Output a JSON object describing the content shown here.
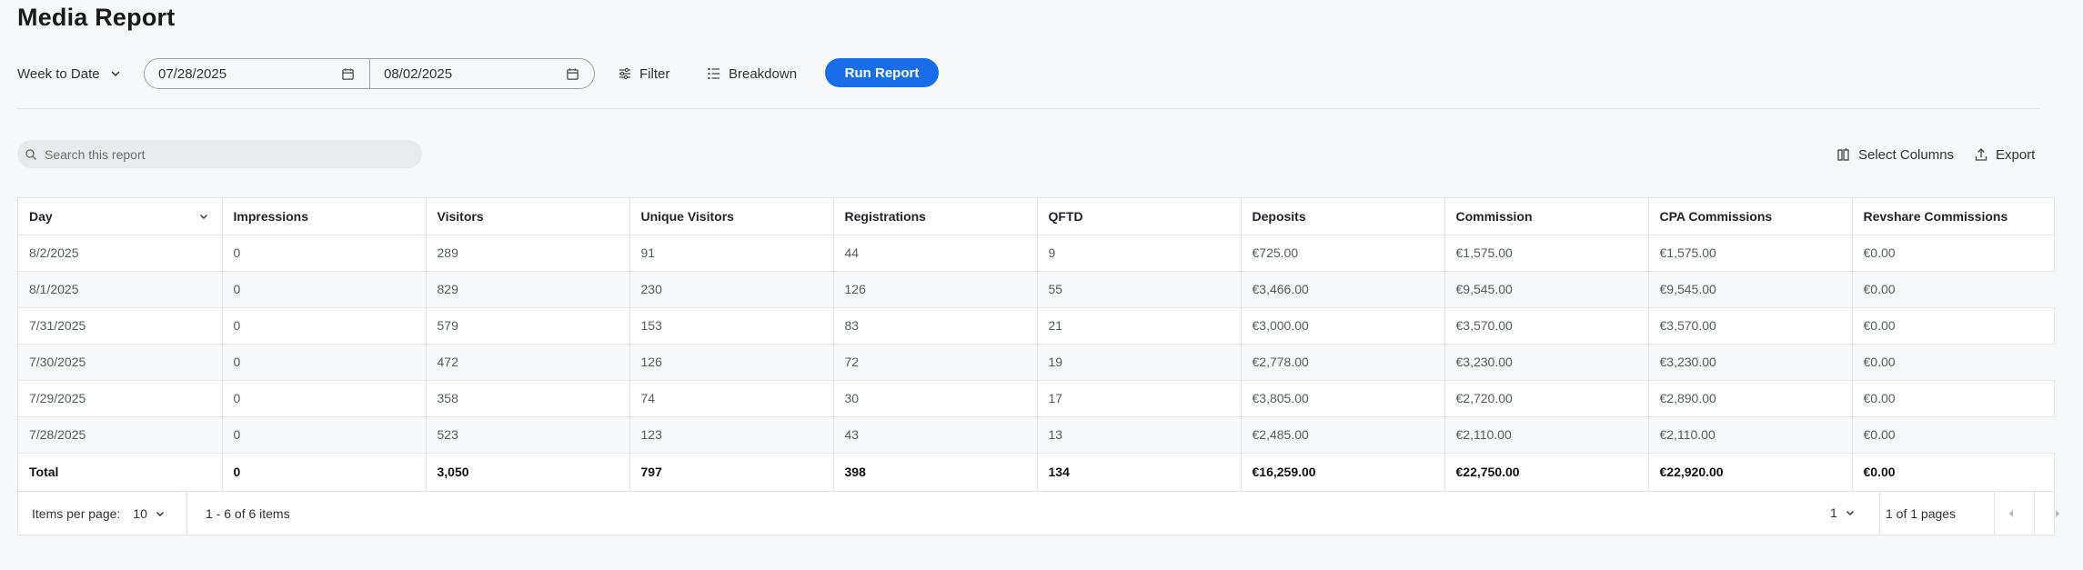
{
  "page": {
    "title": "Media Report"
  },
  "toolbar": {
    "range_label": "Week to Date",
    "start_date": "07/28/2025",
    "end_date": "08/02/2025",
    "filter_label": "Filter",
    "breakdown_label": "Breakdown",
    "run_label": "Run Report",
    "accent": "#1a6de8"
  },
  "search": {
    "placeholder": "Search this report"
  },
  "actions": {
    "select_columns": "Select Columns",
    "export": "Export"
  },
  "table": {
    "columns": [
      "Day",
      "Impressions",
      "Visitors",
      "Unique Visitors",
      "Registrations",
      "QFTD",
      "Deposits",
      "Commission",
      "CPA Commissions",
      "Revshare Commissions"
    ],
    "rows": [
      [
        "8/2/2025",
        "0",
        "289",
        "91",
        "44",
        "9",
        "€725.00",
        "€1,575.00",
        "€1,575.00",
        "€0.00"
      ],
      [
        "8/1/2025",
        "0",
        "829",
        "230",
        "126",
        "55",
        "€3,466.00",
        "€9,545.00",
        "€9,545.00",
        "€0.00"
      ],
      [
        "7/31/2025",
        "0",
        "579",
        "153",
        "83",
        "21",
        "€3,000.00",
        "€3,570.00",
        "€3,570.00",
        "€0.00"
      ],
      [
        "7/30/2025",
        "0",
        "472",
        "126",
        "72",
        "19",
        "€2,778.00",
        "€3,230.00",
        "€3,230.00",
        "€0.00"
      ],
      [
        "7/29/2025",
        "0",
        "358",
        "74",
        "30",
        "17",
        "€3,805.00",
        "€2,720.00",
        "€2,890.00",
        "€0.00"
      ],
      [
        "7/28/2025",
        "0",
        "523",
        "123",
        "43",
        "13",
        "€2,485.00",
        "€2,110.00",
        "€2,110.00",
        "€0.00"
      ]
    ],
    "totals": [
      "Total",
      "0",
      "3,050",
      "797",
      "398",
      "134",
      "€16,259.00",
      "€22,750.00",
      "€22,920.00",
      "€0.00"
    ]
  },
  "pager": {
    "items_per_page_label": "Items per page:",
    "items_per_page": "10",
    "range_text": "1 - 6 of 6 items",
    "current_page": "1",
    "page_info": "1 of 1 pages"
  }
}
